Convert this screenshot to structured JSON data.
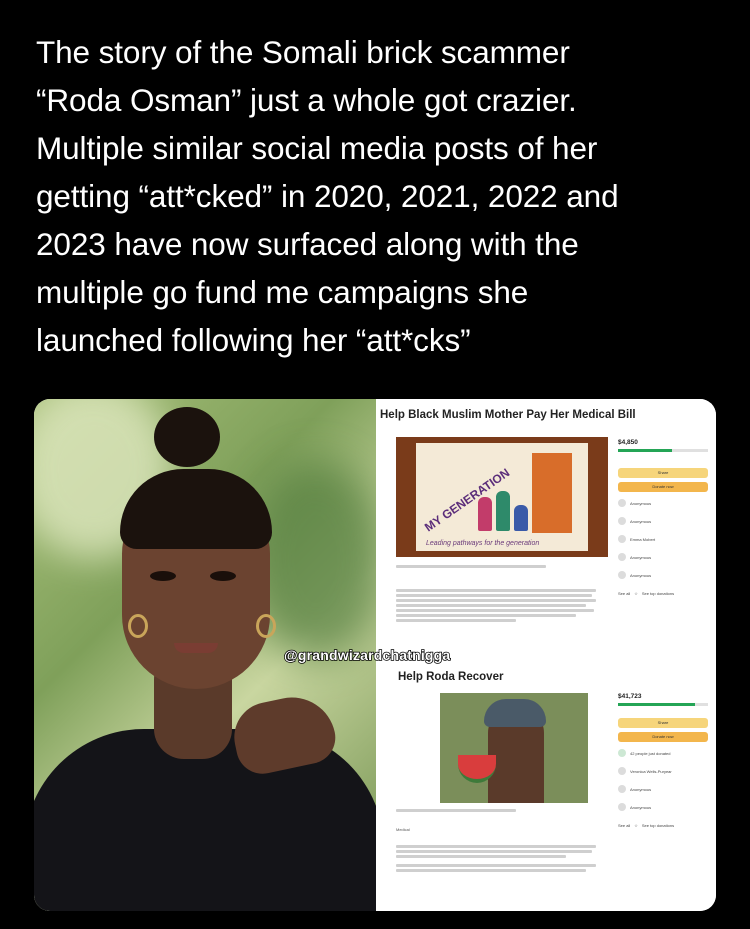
{
  "post": {
    "caption_lines": [
      "The story of the Somali brick scammer",
      "“Roda Osman” just a whole got crazier.",
      "Multiple similar social media posts of her",
      "getting “att*cked” in 2020, 2021, 2022 and",
      "2023 have now surfaced along with the",
      "multiple go fund me campaigns she",
      "launched following her “att*cks”"
    ]
  },
  "image": {
    "watermark": "@grandwizardchatnigga",
    "fundraiser1": {
      "title": "Help Black Muslim Mother Pay Her Medical Bill",
      "raised": "$4,850",
      "banner_logo": "MY GENERATION",
      "banner_tagline": "Leading pathways for the generation",
      "share_label": "Share",
      "donate_label": "Donate now",
      "see_all": "See all",
      "see_top": "See top donations",
      "donors": [
        "Anonymous",
        "Anonymous",
        "Emma Mobert",
        "Anonymous",
        "Anonymous"
      ]
    },
    "fundraiser2": {
      "title": "Help Roda Recover",
      "raised": "$41,723",
      "share_label": "Share",
      "donate_label": "Donate now",
      "recent": "42 people just donated",
      "see_all": "See all",
      "see_top": "See top donations",
      "donors": [
        "Veronica Wells-Puryear",
        "Anonymous",
        "Anonymous"
      ],
      "category": "Medical"
    }
  },
  "colors": {
    "background": "#000000",
    "text": "#ffffff",
    "progress": "#24a556",
    "donate_button": "#f3b64c"
  }
}
